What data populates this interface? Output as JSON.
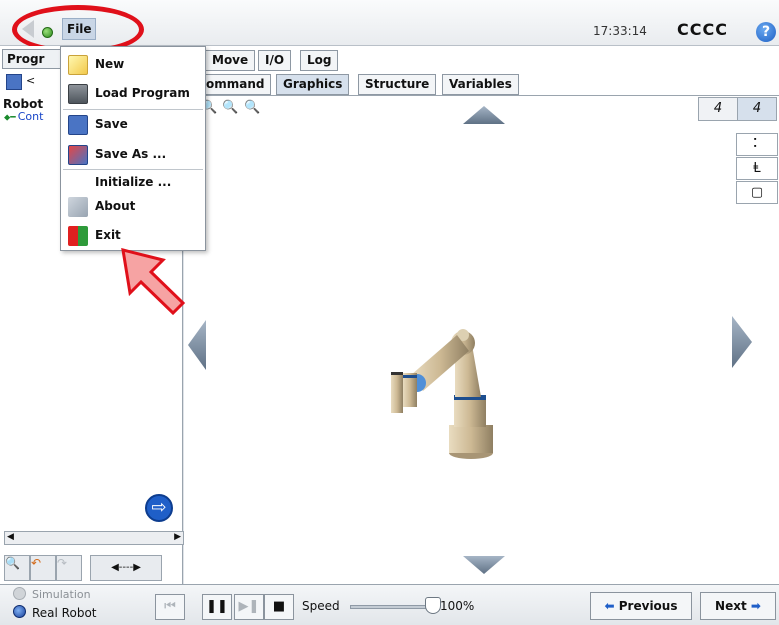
{
  "header": {
    "file_menu_label": "File",
    "clock": "17:33:14",
    "robot_name": "CCCC",
    "help_glyph": "?",
    "status_color": "#2c8a1c"
  },
  "left_panel": {
    "tab_label": "Progr",
    "toolbar_text": "<",
    "tree_root": "Robot",
    "tree_child": "Cont",
    "go_glyph": "⇨",
    "scroll_left": "◀",
    "scroll_right": "▶",
    "tools": [
      "🔍",
      "↶",
      "↷",
      "◀----▶"
    ]
  },
  "main": {
    "tabs_row1": [
      "Move",
      "I/O",
      "Log"
    ],
    "tabs_row2": [
      "ommand",
      "Graphics",
      "Structure",
      "Variables"
    ],
    "active_tab": "Graphics",
    "zoom_icons": [
      "🔍",
      "🔍",
      "🔍"
    ],
    "view_buttons": [
      "4",
      "4"
    ],
    "side_buttons": [
      "⠅",
      "Ⱡ",
      "▢"
    ]
  },
  "file_menu": {
    "items": [
      {
        "label": "New",
        "icon": "new-file-icon"
      },
      {
        "label": "Load Program",
        "icon": "folder-icon"
      },
      {
        "label": "Save",
        "icon": "floppy-disk-icon"
      },
      {
        "label": "Save As ...",
        "icon": "save-as-icon"
      },
      {
        "label": "Initialize ...",
        "icon": ""
      },
      {
        "label": "About",
        "icon": "ur-logo-icon"
      },
      {
        "label": "Exit",
        "icon": "exit-door-icon"
      }
    ]
  },
  "bottom": {
    "simulation_label": "Simulation",
    "real_robot_label": "Real Robot",
    "selected_mode": "Real Robot",
    "speed_label": "Speed",
    "speed_value": "100%",
    "speed_fraction": 1.0,
    "previous_label": "Previous",
    "next_label": "Next",
    "playback_glyphs": [
      "⏮",
      "❚❚",
      "▶❚",
      "■"
    ]
  },
  "annotations": {
    "highlight_color": "#e0101a",
    "arrow_color": "#f6a3a3"
  }
}
